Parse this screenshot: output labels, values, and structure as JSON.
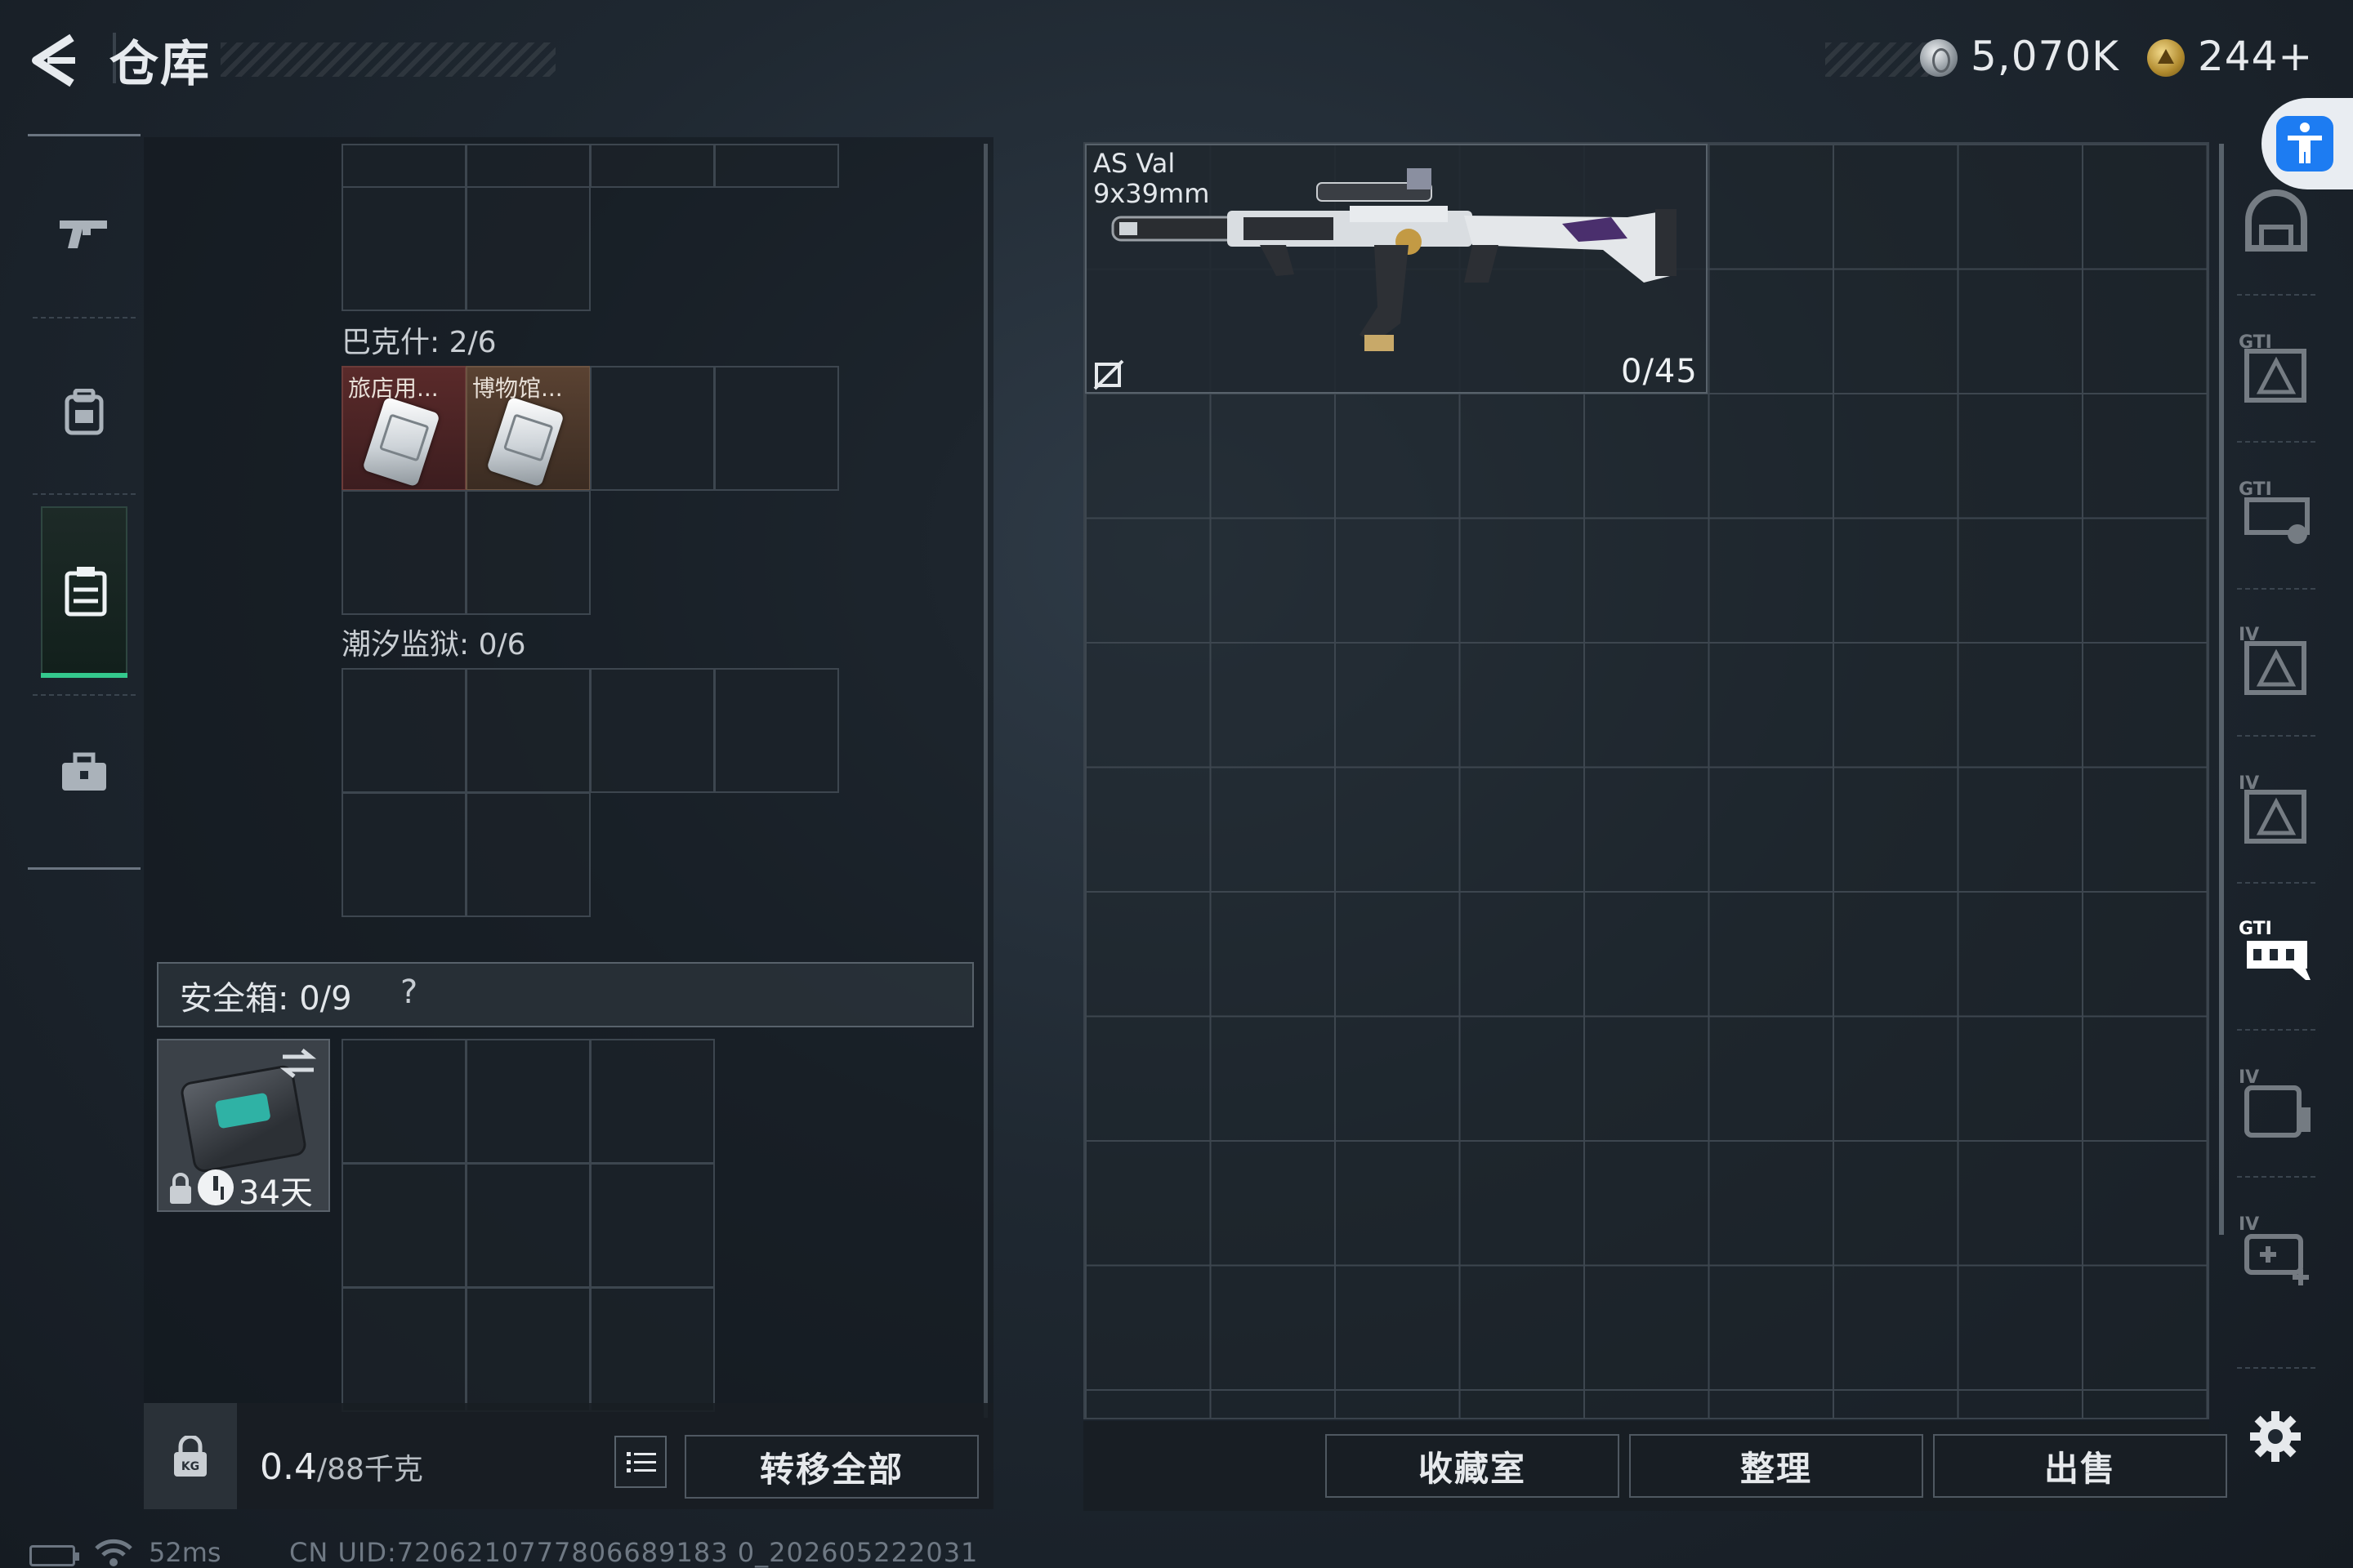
{
  "header": {
    "title": "仓库",
    "currency_silver": "5,070K",
    "currency_gold": "244+"
  },
  "nav": {
    "items": [
      {
        "icon": "gun-icon"
      },
      {
        "icon": "backpack-icon"
      },
      {
        "icon": "storage-icon",
        "active": true
      },
      {
        "icon": "toolbox-icon"
      }
    ]
  },
  "stash": {
    "sections": [
      {
        "label": "巴克什: 2/6",
        "items": [
          "旅店用...",
          "博物馆..."
        ]
      },
      {
        "label": "潮汐监狱: 0/6"
      }
    ],
    "safe_box": {
      "label": "安全箱:  0/9",
      "help": "?",
      "days_left": "34天"
    },
    "weight": {
      "current": "0.4",
      "max": "/88千克"
    },
    "transfer_all_label": "转移全部"
  },
  "container": {
    "weapon": {
      "name": "AS Val",
      "ammo_type": "9x39mm",
      "ammo": "0/45"
    },
    "buttons": {
      "collection": "收藏室",
      "organize": "整理",
      "sell": "出售"
    }
  },
  "sidebar_right": {
    "slots": [
      "helmet-icon",
      "body-armor-icon",
      "chest-rig-icon",
      "armor-iv-icon",
      "armor-iv-2-icon",
      "chest-rig-active-icon",
      "backpack-iv-icon",
      "medic-rig-icon"
    ]
  },
  "status": {
    "ping": "52ms",
    "uid": "CN UID:7206210777806689183 0_202605222031"
  },
  "colors": {
    "accent_green": "#34c98d",
    "accessibility_blue": "#1d7cf2",
    "card_red": "#5a2a2a",
    "card_brown": "#5a4232"
  }
}
